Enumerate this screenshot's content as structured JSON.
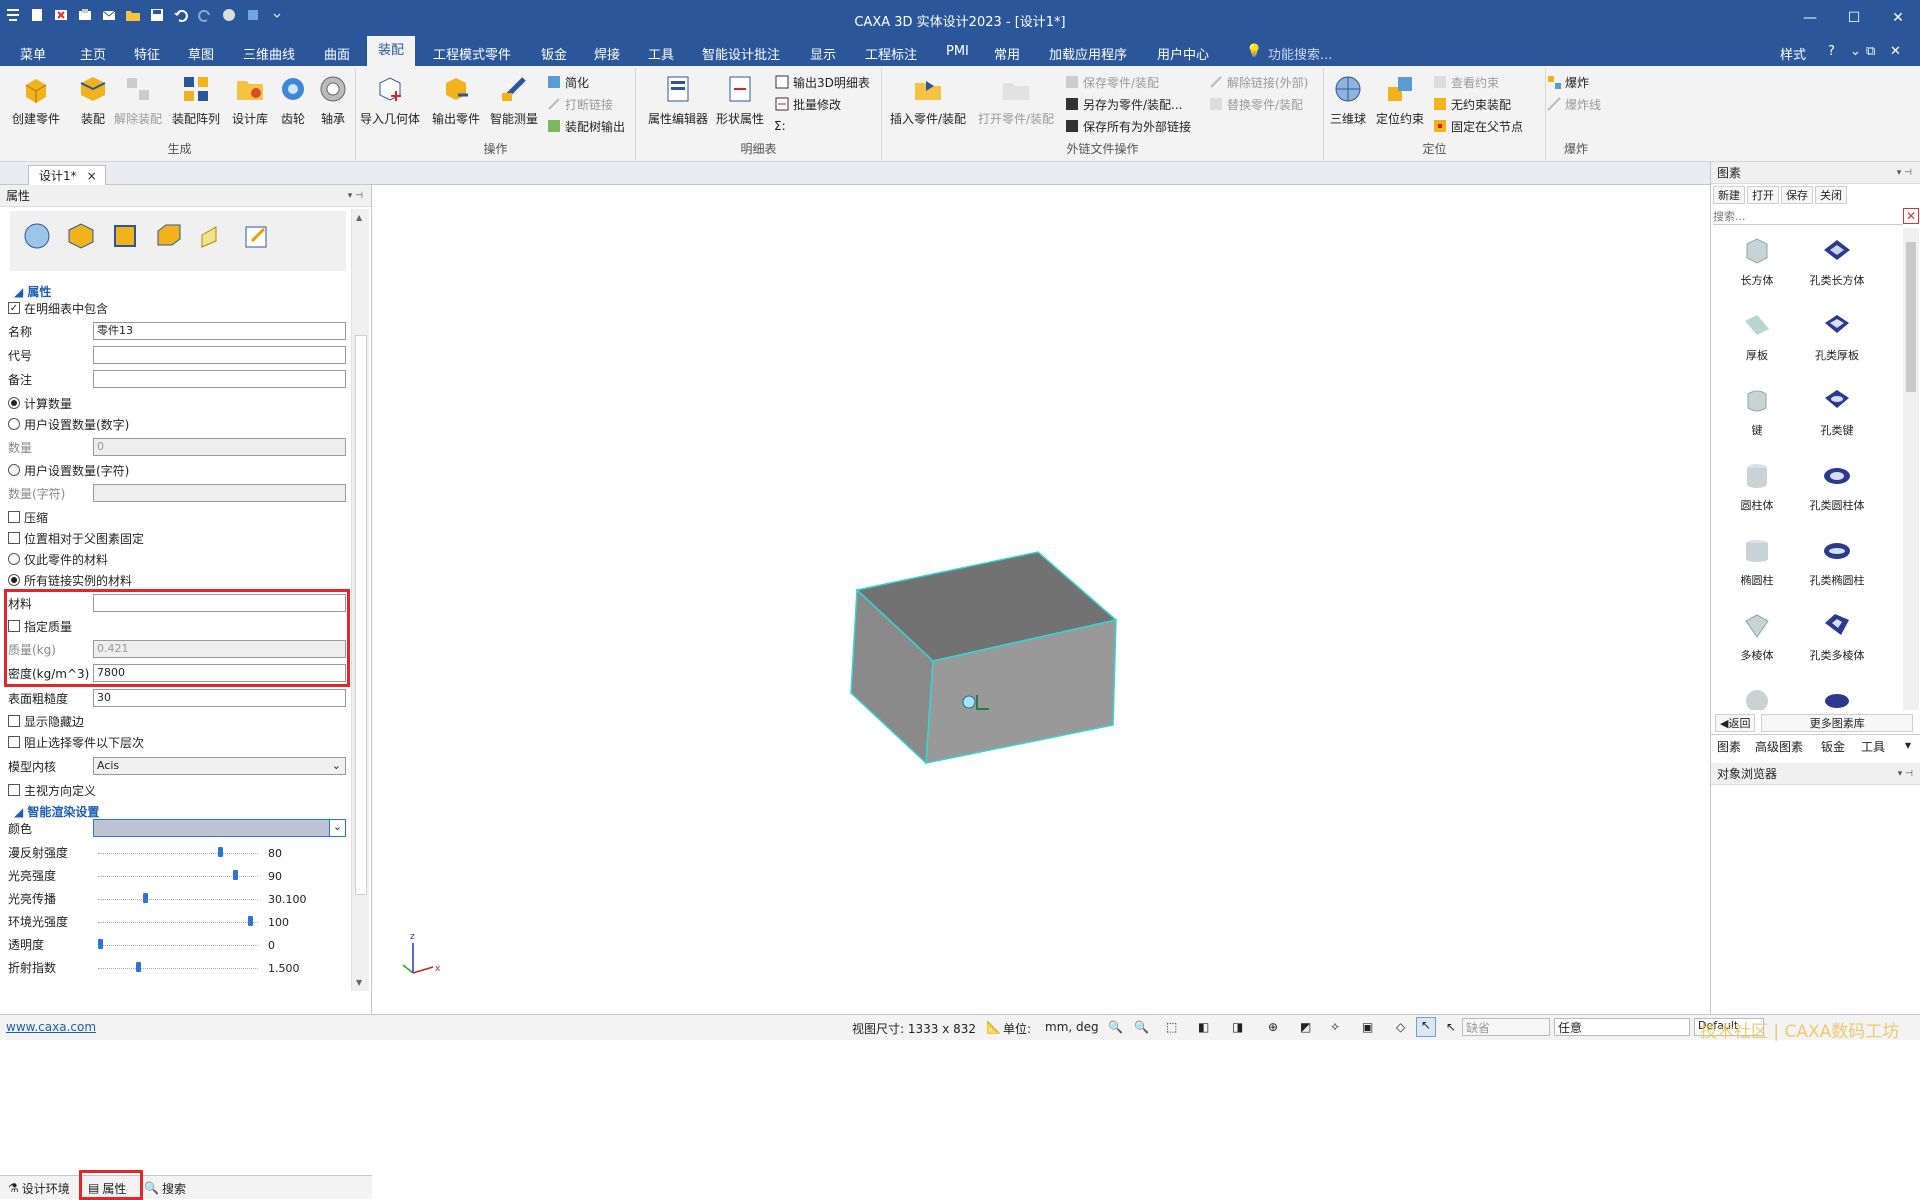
{
  "window": {
    "title": "CAXA 3D 实体设计2023 - [设计1*]"
  },
  "quick_access": [
    "app-icon",
    "new-icon",
    "close-doc-icon",
    "print-icon",
    "mail-icon",
    "open-icon",
    "save-icon",
    "undo-icon",
    "redo-icon",
    "globe-icon",
    "network-icon",
    "dropdown-icon"
  ],
  "menu": {
    "items": [
      "菜单",
      "主页",
      "特征",
      "草图",
      "三维曲线",
      "曲面",
      "装配",
      "工程模式零件",
      "钣金",
      "焊接",
      "工具",
      "智能设计批注",
      "显示",
      "工程标注",
      "PMI",
      "常用",
      "加载应用程序",
      "用户中心"
    ],
    "active": "装配",
    "search": "功能搜索...",
    "style": "样式"
  },
  "ribbon": {
    "groups": {
      "g1": "生成",
      "g2": "操作",
      "g3": "明细表",
      "g4": "外链文件操作",
      "g5": "定位",
      "g6": "爆炸"
    },
    "gen": [
      "创建零件",
      "装配",
      "解除装配",
      "装配阵列",
      "设计库",
      "齿轮",
      "轴承"
    ],
    "op": [
      "导入几何体",
      "输出零件",
      "智能测量"
    ],
    "op_small": [
      "简化",
      "打断链接",
      "装配树输出"
    ],
    "bom": [
      "属性编辑器",
      "形状属性"
    ],
    "bom_small": [
      "输出3D明细表",
      "批量修改",
      "Σ:"
    ],
    "ext": [
      "插入零件/装配",
      "打开零件/装配"
    ],
    "ext_small": [
      "保存零件/装配",
      "另存为零件/装配...",
      "保存所有为外部链接"
    ],
    "ext_small2": [
      "解除链接(外部)",
      "替换零件/装配"
    ],
    "pos": [
      "三维球",
      "定位约束"
    ],
    "pos_small": [
      "查看约束",
      "无约束装配",
      "固定在父节点"
    ],
    "exp_small": [
      "爆炸",
      "爆炸线"
    ]
  },
  "doc_tab": {
    "label": "设计1*",
    "close": "×"
  },
  "left_panel": {
    "title": "属性",
    "section_props": "属性",
    "include_in_bom": "在明细表中包含",
    "name_label": "名称",
    "name_value": "零件13",
    "code_label": "代号",
    "code_value": "",
    "note_label": "备注",
    "note_value": "",
    "calc_qty": "计算数量",
    "user_qty_num": "用户设置数量(数字)",
    "qty_label": "数量",
    "qty_value": "0",
    "user_qty_str": "用户设置数量(字符)",
    "qty_str_label": "数量(字符)",
    "qty_str_value": "",
    "compress": "压缩",
    "fixed_rel_parent": "位置相对于父图素固定",
    "this_part_mat": "仅此零件的材料",
    "all_linked_mat": "所有链接实例的材料",
    "material_label": "材料",
    "material_value": "",
    "specify_mass": "指定质量",
    "mass_label": "质量(kg)",
    "mass_value": "0.421",
    "density_label": "密度(kg/m^3)",
    "density_value": "7800",
    "roughness_label": "表面粗糙度",
    "roughness_value": "30",
    "show_hidden": "显示隐藏边",
    "block_select": "阻止选择零件以下层次",
    "kernel_label": "模型内核",
    "kernel_value": "Acis",
    "main_view_def": "主视方向定义",
    "section_render": "智能渲染设置",
    "color_label": "颜色",
    "sliders": [
      {
        "label": "漫反射强度",
        "value": "80",
        "pos": 0.8
      },
      {
        "label": "光亮强度",
        "value": "90",
        "pos": 0.9
      },
      {
        "label": "光亮传播",
        "value": "30.100",
        "pos": 0.3
      },
      {
        "label": "环境光强度",
        "value": "100",
        "pos": 1.0
      },
      {
        "label": "透明度",
        "value": "0",
        "pos": 0.0
      },
      {
        "label": "折射指数",
        "value": "1.500",
        "pos": 0.25
      }
    ],
    "bottom_tabs": [
      "设计环境",
      "属性",
      "搜索"
    ]
  },
  "viewport": {
    "axis_labels": {
      "z": "z",
      "x": "x"
    }
  },
  "right_panel": {
    "title": "图素",
    "toolbar": [
      "新建",
      "打开",
      "保存",
      "关闭"
    ],
    "search_placeholder": "搜索...",
    "items": [
      "长方体",
      "孔类长方体",
      "厚板",
      "孔类厚板",
      "键",
      "孔类键",
      "圆柱体",
      "孔类圆柱体",
      "椭圆柱",
      "孔类椭圆柱",
      "多棱体",
      "孔类多棱体"
    ],
    "back": "返回",
    "more": "更多图素库",
    "tabs": [
      "图素",
      "高级图素",
      "钣金",
      "工具"
    ],
    "browser_title": "对象浏览器"
  },
  "status": {
    "url": "www.caxa.com",
    "view_size": "视图尺寸: 1333 x 832",
    "unit_label": "单位:",
    "unit_value": "mm, deg",
    "field1": "缺省",
    "field2": "任意",
    "field3": "Default",
    "watermark": "技术社区 | CAXA数码工坊"
  }
}
